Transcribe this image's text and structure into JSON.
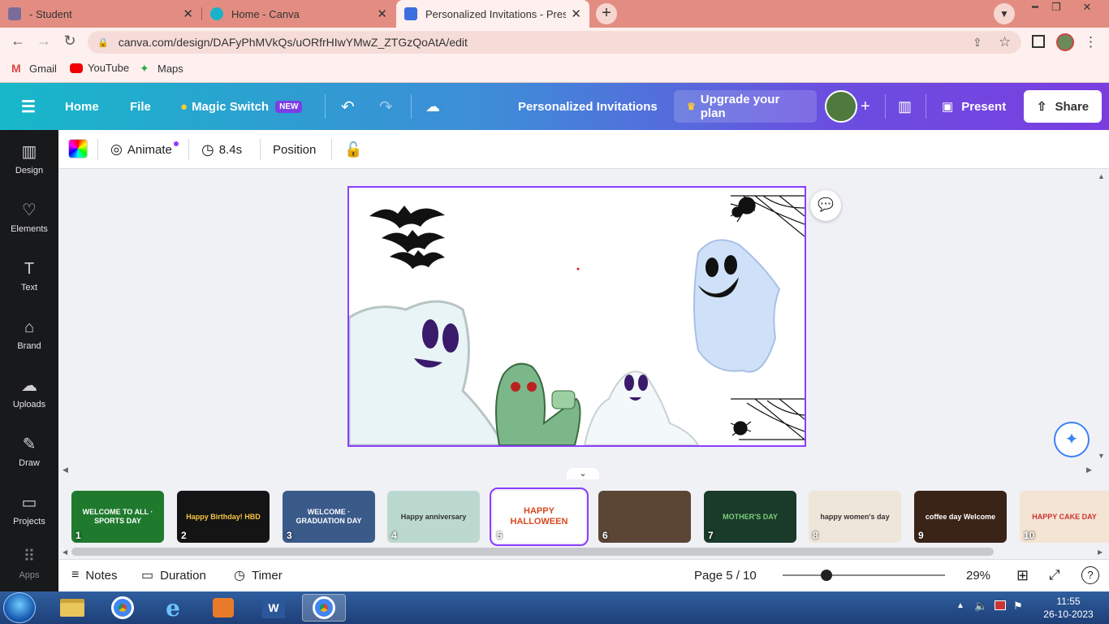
{
  "browser": {
    "tabs": [
      {
        "title": "- Student",
        "favicon_color": "#7a6c9a"
      },
      {
        "title": "Home - Canva",
        "favicon_color": "#1ab2c8"
      },
      {
        "title": "Personalized Invitations - Present",
        "favicon_color": "#3b6fe0"
      }
    ],
    "new_tab_label": "+",
    "url": "canva.com/design/DAFyPhMVkQs/uORfrHIwYMwZ_ZTGzQoAtA/edit",
    "bookmarks": [
      "Gmail",
      "YouTube",
      "Maps"
    ]
  },
  "header": {
    "home": "Home",
    "file": "File",
    "magic_switch": "Magic Switch",
    "new_badge": "NEW",
    "title": "Personalized Invitations",
    "upgrade": "Upgrade your plan",
    "present": "Present",
    "share": "Share"
  },
  "sidebar": {
    "items": [
      {
        "label": "Design",
        "icon": "layout-icon"
      },
      {
        "label": "Elements",
        "icon": "shapes-icon"
      },
      {
        "label": "Text",
        "icon": "text-icon"
      },
      {
        "label": "Brand",
        "icon": "brand-icon"
      },
      {
        "label": "Uploads",
        "icon": "cloud-upload-icon"
      },
      {
        "label": "Draw",
        "icon": "pen-icon"
      },
      {
        "label": "Projects",
        "icon": "folder-icon"
      },
      {
        "label": "Apps",
        "icon": "grid-icon"
      }
    ]
  },
  "editor_toolbar": {
    "animate": "Animate",
    "duration": "8.4s",
    "position": "Position"
  },
  "filmstrip": {
    "pages": [
      {
        "num": "1",
        "text": "WELCOME TO ALL · SPORTS DAY",
        "bg": "#1f7a2e"
      },
      {
        "num": "2",
        "text": "Happy Birthday! HBD",
        "bg": "#141414"
      },
      {
        "num": "3",
        "text": "WELCOME · GRADUATION DAY",
        "bg": "#3a5a8a"
      },
      {
        "num": "4",
        "text": "Happy anniversary",
        "bg": "#bcd9cf"
      },
      {
        "num": "5",
        "text": "HAPPY HALLOWEEN",
        "bg": "#ffffff"
      },
      {
        "num": "6",
        "text": "",
        "bg": "#5b4636"
      },
      {
        "num": "7",
        "text": "MOTHER'S DAY",
        "bg": "#1a3a2a"
      },
      {
        "num": "8",
        "text": "happy women's day",
        "bg": "#efe6da"
      },
      {
        "num": "9",
        "text": "coffee day Welcome",
        "bg": "#3a2418"
      },
      {
        "num": "10",
        "text": "HAPPY CAKE DAY",
        "bg": "#f4e4d4"
      }
    ],
    "selected": 5
  },
  "footer": {
    "notes": "Notes",
    "duration": "Duration",
    "timer": "Timer",
    "page_indicator": "Page 5 / 10",
    "zoom": "29%",
    "zoom_fraction": 0.27
  },
  "taskbar": {
    "time": "11:55",
    "date": "26-10-2023"
  },
  "colors": {
    "accent": "#8b3dff",
    "header_gradient_start": "#17b8c9",
    "header_gradient_end": "#7a3ee0"
  }
}
